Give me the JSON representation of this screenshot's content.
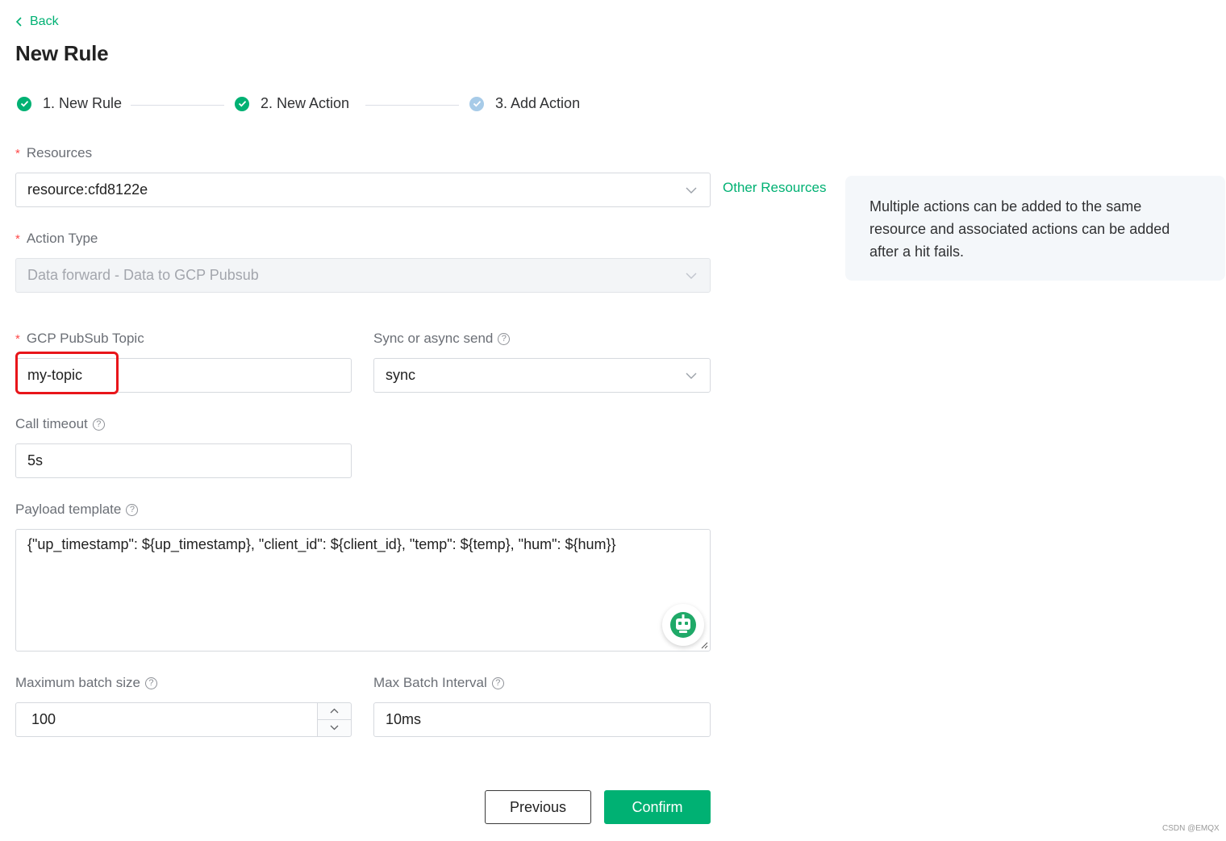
{
  "header": {
    "back_label": "Back",
    "title": "New Rule"
  },
  "steps": [
    {
      "label": "1. New Rule",
      "status": "done"
    },
    {
      "label": "2. New Action",
      "status": "done"
    },
    {
      "label": "3. Add Action",
      "status": "current"
    }
  ],
  "form": {
    "resources": {
      "label": "Resources",
      "value": "resource:cfd8122e",
      "other_link": "Other Resources"
    },
    "action_type": {
      "label": "Action Type",
      "value": "Data forward - Data to GCP Pubsub"
    },
    "topic": {
      "label": "GCP PubSub Topic",
      "value": "my-topic"
    },
    "sync_mode": {
      "label": "Sync or async send",
      "value": "sync"
    },
    "call_timeout": {
      "label": "Call timeout",
      "value": "5s"
    },
    "payload_template": {
      "label": "Payload template",
      "value": "{\"up_timestamp\": ${up_timestamp}, \"client_id\": ${client_id}, \"temp\": ${temp}, \"hum\": ${hum}}"
    },
    "max_batch_size": {
      "label": "Maximum batch size",
      "value": "100"
    },
    "max_batch_interval": {
      "label": "Max Batch Interval",
      "value": "10ms"
    }
  },
  "tip": {
    "line1": "Multiple actions can be added to the same",
    "line2": "resource and associated actions can be added",
    "line3": "after a hit fails."
  },
  "buttons": {
    "previous": "Previous",
    "confirm": "Confirm"
  },
  "watermark": "CSDN @EMQX",
  "colors": {
    "accent": "#00b173",
    "step_current": "#a7cbe8",
    "highlight": "#e8151a",
    "required": "#ff4949"
  },
  "icons": {
    "help": "?",
    "back": "chevron-left-icon",
    "dropdown": "chevron-down-icon"
  }
}
